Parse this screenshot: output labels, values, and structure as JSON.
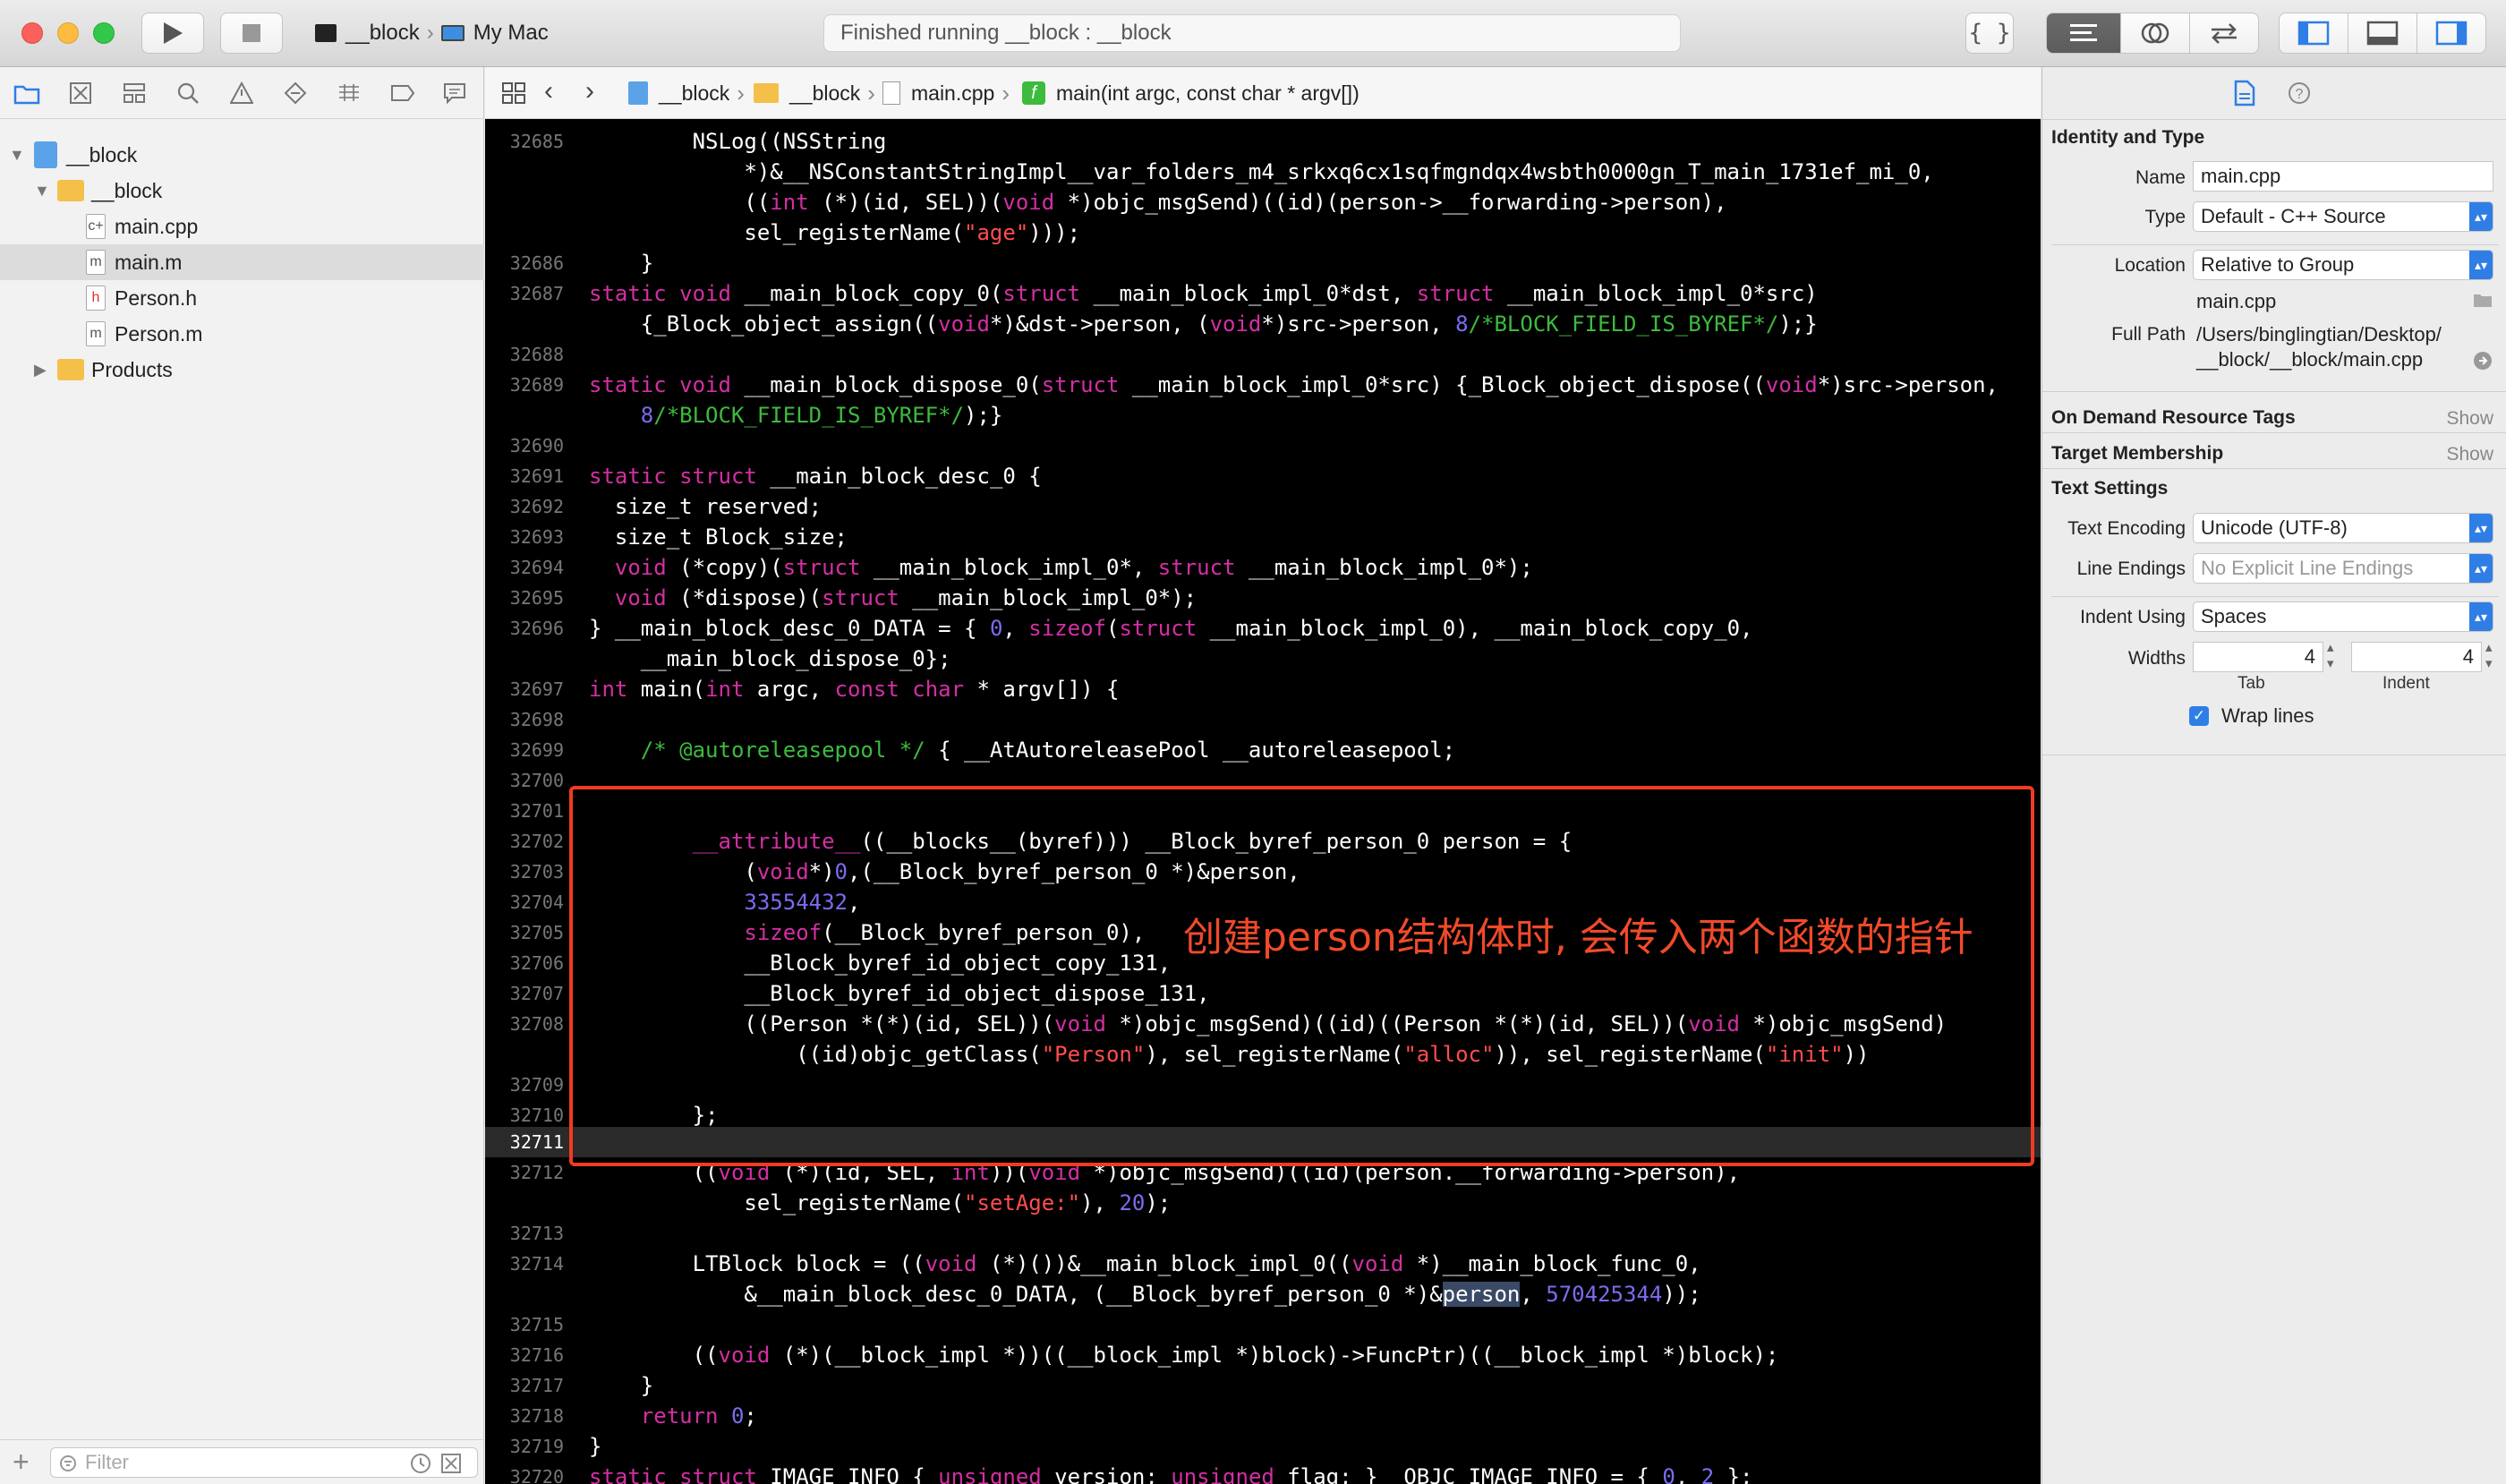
{
  "toolbar": {
    "scheme_target": "__block",
    "scheme_device": "My Mac",
    "activity": "Finished running __block : __block"
  },
  "navigator": {
    "items": [
      {
        "label": "__block",
        "level": 0,
        "kind": "project",
        "expanded": true
      },
      {
        "label": "__block",
        "level": 1,
        "kind": "folder",
        "expanded": true
      },
      {
        "label": "main.cpp",
        "level": 2,
        "kind": "file",
        "badge": "c+"
      },
      {
        "label": "main.m",
        "level": 2,
        "kind": "file",
        "badge": "m",
        "selected": true
      },
      {
        "label": "Person.h",
        "level": 2,
        "kind": "file",
        "badge": "h"
      },
      {
        "label": "Person.m",
        "level": 2,
        "kind": "file",
        "badge": "m"
      },
      {
        "label": "Products",
        "level": 0,
        "kind": "folder",
        "expanded": false
      }
    ],
    "filter_placeholder": "Filter"
  },
  "jumpbar": {
    "project": "__block",
    "group": "__block",
    "file": "main.cpp",
    "symbol": "main(int argc, const char * argv[])"
  },
  "editor": {
    "current_line": "32711",
    "annotation": "创建person结构体时, 会传入两个函数的指针"
  },
  "inspector": {
    "section_identity": "Identity and Type",
    "name_label": "Name",
    "name_value": "main.cpp",
    "type_label": "Type",
    "type_value": "Default - C++ Source",
    "location_label": "Location",
    "location_value": "Relative to Group",
    "location_file": "main.cpp",
    "fullpath_label": "Full Path",
    "fullpath_line1": "/Users/binglingtian/Desktop/",
    "fullpath_line2": "__block/__block/main.cpp",
    "section_ondemand": "On Demand Resource Tags",
    "section_target": "Target Membership",
    "show_label": "Show",
    "section_text": "Text Settings",
    "encoding_label": "Text Encoding",
    "encoding_value": "Unicode (UTF-8)",
    "lineendings_label": "Line Endings",
    "lineendings_value": "No Explicit Line Endings",
    "indent_label": "Indent Using",
    "indent_value": "Spaces",
    "widths_label": "Widths",
    "tab_width": "4",
    "indent_width": "4",
    "tab_caption": "Tab",
    "indent_caption": "Indent",
    "wrap_label": "Wrap lines",
    "wrap_checked": true
  }
}
